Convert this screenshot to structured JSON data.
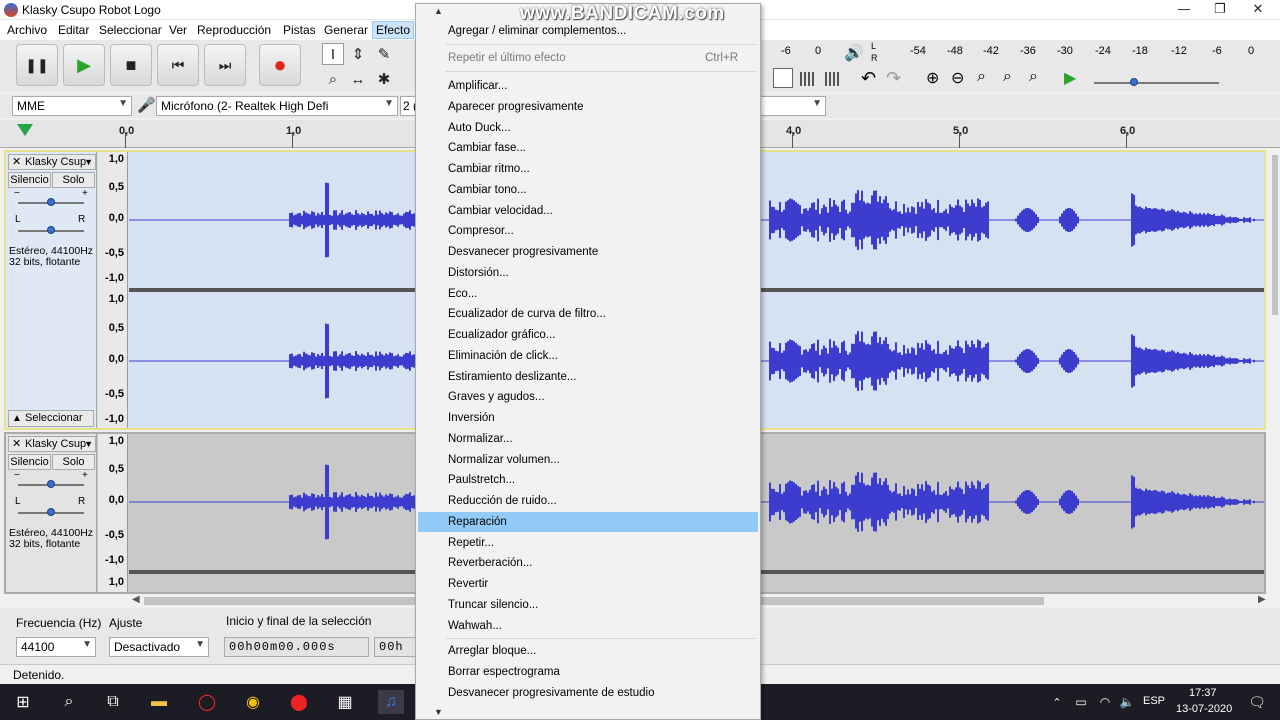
{
  "window": {
    "title": "Klasky Csupo Robot Logo",
    "minimize": "—",
    "maximize": "❐",
    "close": "✕"
  },
  "watermark": "www.BANDICAM.com",
  "menubar": [
    "Archivo",
    "Editar",
    "Seleccionar",
    "Ver",
    "Reproducción",
    "Pistas",
    "Generar",
    "Efecto"
  ],
  "transport": {
    "pause": "❚❚",
    "play": "▶",
    "stop": "■",
    "skip_start": "⏮",
    "skip_end": "⏭",
    "record": "●"
  },
  "tools": {
    "select": "I",
    "envelope": "⇕",
    "draw": "✎",
    "zoom": "⌕",
    "timeshift": "↔",
    "multi": "✱"
  },
  "meter_ticks_left": [
    "-6",
    "0"
  ],
  "meter_ticks_right": [
    "-54",
    "-48",
    "-42",
    "-36",
    "-30",
    "-24",
    "-18",
    "-12",
    "-6",
    "0"
  ],
  "meter_lr": [
    "L",
    "R"
  ],
  "devices": {
    "host": "MME",
    "mic": "Micrófono (2- Realtek High Defi",
    "channels": "2 (",
    "output": ""
  },
  "ruler": {
    "ticks_left": [
      "0,0",
      "1,0"
    ],
    "ticks_right": [
      "4,0",
      "5,0",
      "6,0"
    ]
  },
  "track1": {
    "name": "Klasky Csup",
    "close": "✕",
    "mute": "Silencio",
    "solo": "Solo",
    "gain_minus": "−",
    "gain_plus": "+",
    "pan_l": "L",
    "pan_r": "R",
    "info1": "Estéreo, 44100Hz",
    "info2": "32 bits, flotante",
    "select_label": "Seleccionar",
    "scale_top": [
      "1,0",
      "0,5",
      "0,0",
      "-0,5",
      "-1,0"
    ],
    "scale_bottom": [
      "1,0",
      "0,5",
      "0,0",
      "-0,5",
      "-1,0"
    ]
  },
  "track2": {
    "name": "Klasky Csup",
    "close": "✕",
    "mute": "Silencio",
    "solo": "Solo",
    "gain_minus": "−",
    "gain_plus": "+",
    "pan_l": "L",
    "pan_r": "R",
    "info1": "Estéreo, 44100Hz",
    "info2": "32 bits, flotante",
    "scale_top": [
      "1,0",
      "0,5",
      "0,0",
      "-0,5",
      "-1,0"
    ],
    "scale_bottom_first": "1,0"
  },
  "selection_toolbar": {
    "rate_label": "Frecuencia (Hz)",
    "snap_label": "Ajuste",
    "range_label": "Inicio y final de la selección",
    "rate_value": "44100",
    "snap_value": "Desactivado",
    "time_start": "00h00m00.000s",
    "time_end": "00h"
  },
  "status": "Detenido.",
  "taskbar": {
    "time": "17:37",
    "date": "13-07-2020",
    "lang": "ESP"
  },
  "effect_menu": {
    "items_top": [
      "Agregar / eliminar complementos..."
    ],
    "repeat_last": "Repetir el último efecto",
    "repeat_shortcut": "Ctrl+R",
    "items": [
      "Amplificar...",
      "Aparecer progresivamente",
      "Auto Duck...",
      "Cambiar fase...",
      "Cambiar ritmo...",
      "Cambiar tono...",
      "Cambiar velocidad...",
      "Compresor...",
      "Desvanecer progresivamente",
      "Distorsión...",
      "Eco...",
      "Ecualizador de curva de filtro...",
      "Ecualizador gráfico...",
      "Eliminación de click...",
      "Estiramiento deslizante...",
      "Graves y agudos...",
      "Inversión",
      "Normalizar...",
      "Normalizar volumen...",
      "Paulstretch...",
      "Reducción de ruido...",
      "Reparación",
      "Repetir...",
      "Reverberación...",
      "Revertir",
      "Truncar silencio...",
      "Wahwah..."
    ],
    "highlighted": "Reparación",
    "items_bottom": [
      "Arreglar bloque...",
      "Borrar espectrograma",
      "Desvanecer progresivamente de estudio"
    ]
  },
  "colors": {
    "wave": "#3c3ccf",
    "selected_bg": "#d6e1f1",
    "track_border": "#e7e28c",
    "highlight": "#91c9f7"
  }
}
